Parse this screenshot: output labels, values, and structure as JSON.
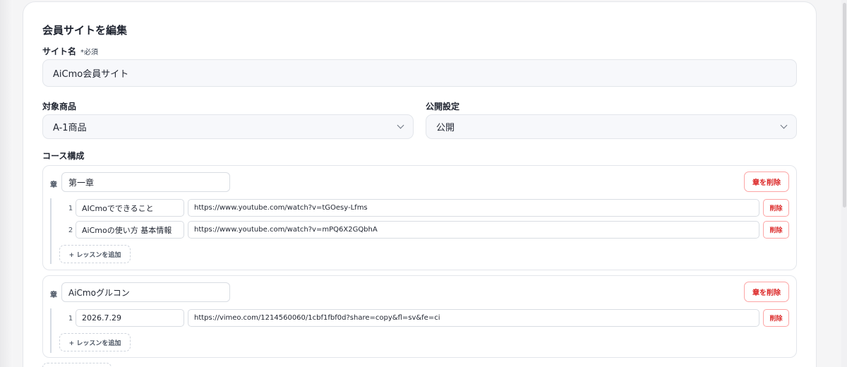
{
  "form": {
    "title": "会員サイトを編集",
    "site_name": {
      "label": "サイト名",
      "required_mark": "*必須",
      "value": "AiCmo会員サイト"
    },
    "product": {
      "label": "対象商品",
      "value": "A-1商品"
    },
    "visibility": {
      "label": "公開設定",
      "value": "公開"
    },
    "course_label": "コース構成"
  },
  "icons": {
    "chapter": "章",
    "select_arrow": "chevron-down-icon",
    "add": "+"
  },
  "chapters": [
    {
      "title": "第一章",
      "delete_label": "章を削除",
      "lessons": [
        {
          "number": "1",
          "title": "AICmoでできること",
          "url": "https://www.youtube.com/watch?v=tGOesy-Lfms",
          "delete_label": "削除"
        },
        {
          "number": "2",
          "title": "AiCmoの使い方 基本情報",
          "url": "https://www.youtube.com/watch?v=mPQ6X2GQbhA",
          "delete_label": "削除"
        }
      ],
      "add_lesson_label": "+ レッスンを追加"
    },
    {
      "title": "AiCmoグルコン",
      "delete_label": "章を削除",
      "lessons": [
        {
          "number": "1",
          "title": "2026.7.29",
          "url": "https://vimeo.com/1214560060/1cbf1fbf0d?share=copy&fl=sv&fe=ci",
          "delete_label": "削除"
        }
      ],
      "add_lesson_label": "+ レッスンを追加"
    }
  ],
  "colors": {
    "danger": "#dc2626",
    "danger_border": "#fca5a5",
    "input_bg": "#f7f8fb",
    "text": "#1f2430"
  }
}
